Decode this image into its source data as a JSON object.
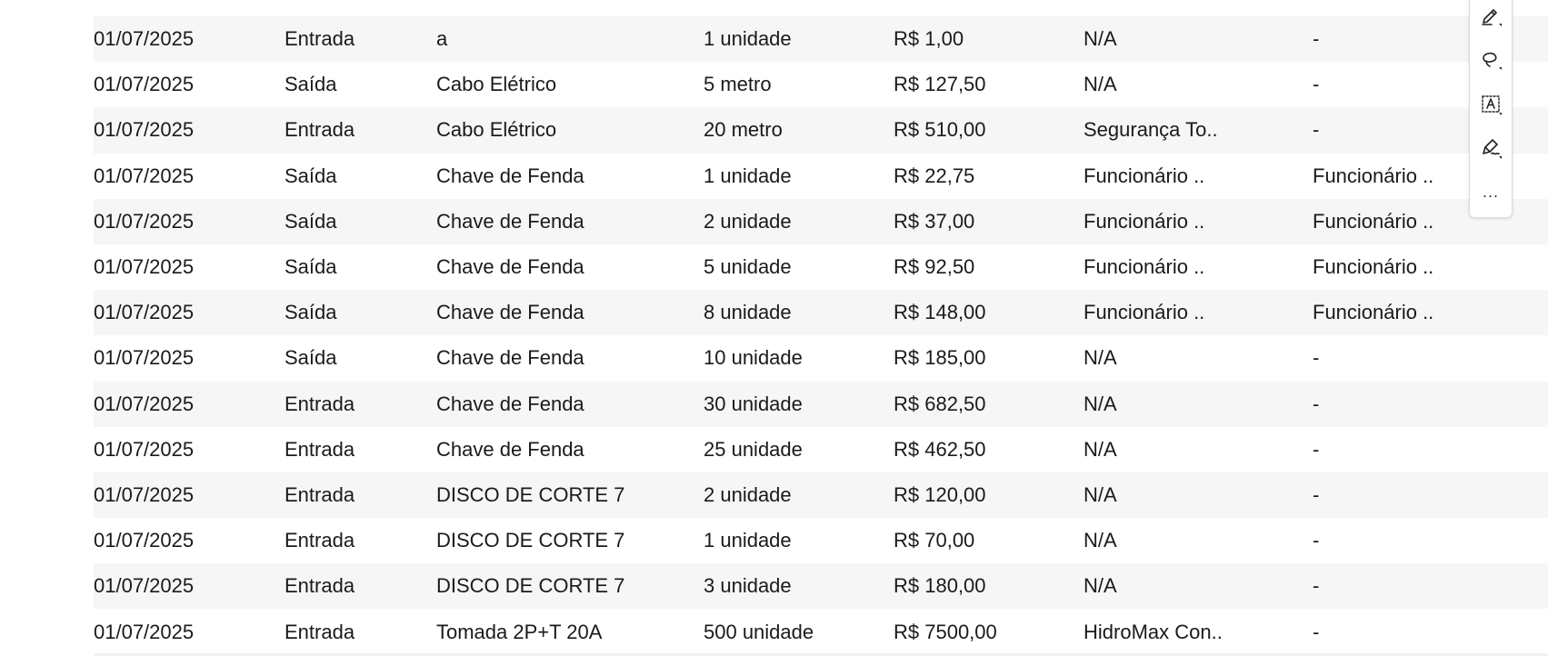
{
  "rows": [
    {
      "date": "01/07/2025",
      "type": "Entrada",
      "product": "a",
      "quantity": "1 unidade",
      "value": "R$ 1,00",
      "supplier": "N/A",
      "employee": "-"
    },
    {
      "date": "01/07/2025",
      "type": "Saída",
      "product": "Cabo Elétrico",
      "quantity": "5 metro",
      "value": "R$ 127,50",
      "supplier": "N/A",
      "employee": "-"
    },
    {
      "date": "01/07/2025",
      "type": "Entrada",
      "product": "Cabo Elétrico",
      "quantity": "20 metro",
      "value": "R$ 510,00",
      "supplier": "Segurança To..",
      "employee": "-"
    },
    {
      "date": "01/07/2025",
      "type": "Saída",
      "product": "Chave de Fenda",
      "quantity": "1 unidade",
      "value": "R$ 22,75",
      "supplier": "Funcionário ..",
      "employee": "Funcionário .."
    },
    {
      "date": "01/07/2025",
      "type": "Saída",
      "product": "Chave de Fenda",
      "quantity": "2 unidade",
      "value": "R$ 37,00",
      "supplier": "Funcionário ..",
      "employee": "Funcionário .."
    },
    {
      "date": "01/07/2025",
      "type": "Saída",
      "product": "Chave de Fenda",
      "quantity": "5 unidade",
      "value": "R$ 92,50",
      "supplier": "Funcionário ..",
      "employee": "Funcionário .."
    },
    {
      "date": "01/07/2025",
      "type": "Saída",
      "product": "Chave de Fenda",
      "quantity": "8 unidade",
      "value": "R$ 148,00",
      "supplier": "Funcionário ..",
      "employee": "Funcionário .."
    },
    {
      "date": "01/07/2025",
      "type": "Saída",
      "product": "Chave de Fenda",
      "quantity": "10 unidade",
      "value": "R$ 185,00",
      "supplier": "N/A",
      "employee": "-"
    },
    {
      "date": "01/07/2025",
      "type": "Entrada",
      "product": "Chave de Fenda",
      "quantity": "30 unidade",
      "value": "R$ 682,50",
      "supplier": "N/A",
      "employee": "-"
    },
    {
      "date": "01/07/2025",
      "type": "Entrada",
      "product": "Chave de Fenda",
      "quantity": "25 unidade",
      "value": "R$ 462,50",
      "supplier": "N/A",
      "employee": "-"
    },
    {
      "date": "01/07/2025",
      "type": "Entrada",
      "product": "DISCO DE CORTE 7",
      "quantity": "2 unidade",
      "value": "R$ 120,00",
      "supplier": "N/A",
      "employee": "-"
    },
    {
      "date": "01/07/2025",
      "type": "Entrada",
      "product": "DISCO DE CORTE 7",
      "quantity": "1 unidade",
      "value": "R$ 70,00",
      "supplier": "N/A",
      "employee": "-"
    },
    {
      "date": "01/07/2025",
      "type": "Entrada",
      "product": "DISCO DE CORTE 7",
      "quantity": "3 unidade",
      "value": "R$ 180,00",
      "supplier": "N/A",
      "employee": "-"
    },
    {
      "date": "01/07/2025",
      "type": "Entrada",
      "product": "Tomada 2P+T 20A",
      "quantity": "500 unidade",
      "value": "R$ 7500,00",
      "supplier": "HidroMax Con..",
      "employee": "-"
    }
  ],
  "toolbar": {
    "tools": [
      "highlight-pen-icon",
      "lasso-icon",
      "text-select-icon",
      "signature-pen-icon"
    ],
    "more_label": "..."
  }
}
